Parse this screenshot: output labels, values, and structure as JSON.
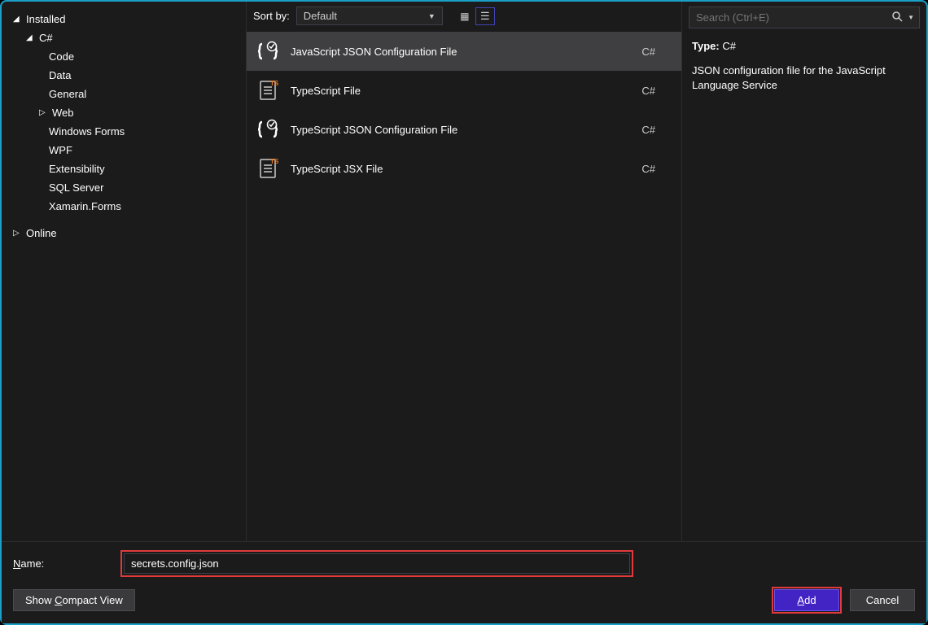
{
  "sidebar": {
    "installed_label": "Installed",
    "csharp_label": "C#",
    "categories": {
      "code": "Code",
      "data": "Data",
      "general": "General",
      "web": "Web",
      "windows_forms": "Windows Forms",
      "wpf": "WPF",
      "extensibility": "Extensibility",
      "sql_server": "SQL Server",
      "xamarin_forms": "Xamarin.Forms"
    },
    "online_label": "Online"
  },
  "center": {
    "sort_by_label": "Sort by:",
    "sort_value": "Default",
    "templates": [
      {
        "name": "JavaScript JSON Configuration File",
        "lang": "C#",
        "icon": "json"
      },
      {
        "name": "TypeScript File",
        "lang": "C#",
        "icon": "ts-file"
      },
      {
        "name": "TypeScript JSON Configuration File",
        "lang": "C#",
        "icon": "json"
      },
      {
        "name": "TypeScript JSX File",
        "lang": "C#",
        "icon": "ts-file"
      }
    ]
  },
  "right": {
    "search_placeholder": "Search (Ctrl+E)",
    "type_label": "Type:",
    "type_value": "C#",
    "description": "JSON configuration file for the JavaScript Language Service"
  },
  "footer": {
    "name_label_prefix": "N",
    "name_label_rest": "ame:",
    "name_value": "secrets.config.json",
    "compact_prefix": "Show ",
    "compact_ul": "C",
    "compact_rest": "ompact View",
    "add_ul": "A",
    "add_rest": "dd",
    "cancel_label": "Cancel"
  }
}
